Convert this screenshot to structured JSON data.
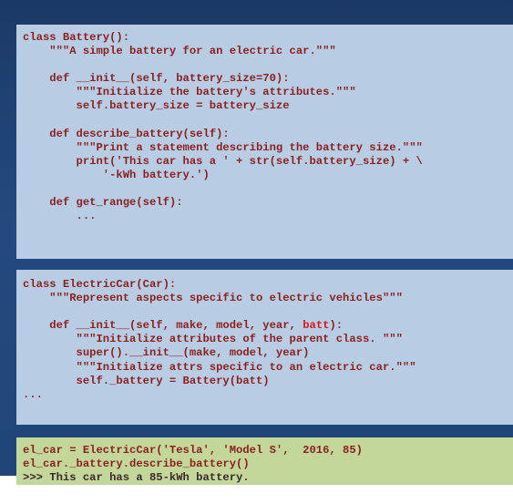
{
  "code_block_1": {
    "lines": [
      "class Battery():",
      "    \"\"\"A simple battery for an electric car.\"\"\"",
      "",
      "    def __init__(self, battery_size=70):",
      "        \"\"\"Initialize the battery's attributes.\"\"\"",
      "        self.battery_size = battery_size",
      "",
      "    def describe_battery(self):",
      "        \"\"\"Print a statement describing the battery size.\"\"\"",
      "        print('This car has a ' + str(self.battery_size) + \\",
      "            '-kWh battery.')",
      "",
      "    def get_range(self):",
      "        ..."
    ]
  },
  "code_block_2": {
    "lines": [
      "class ElectricCar(Car):",
      "    \"\"\"Represent aspects specific to electric vehicles\"\"\"",
      "",
      "    def __init__(self, make, model, year, batt):",
      "        \"\"\"Initialize attributes of the parent class. \"\"\"",
      "        super().__init__(make, model, year)",
      "        \"\"\"Initialize attrs specific to an electric car.\"\"\"",
      "        self._battery = Battery(batt)",
      "..."
    ],
    "line4_prefix": "    def __init__(self, make, model, year, ",
    "line4_highlight": "batt",
    "line4_suffix": "):"
  },
  "code_block_3": {
    "line1": "el_car = ElectricCar('Tesla', 'Model S',  2016, 85)",
    "line2": "el_car._battery.describe_battery()",
    "line3": ">>> This car has a 85-kWh battery."
  },
  "colors": {
    "background": "#234a80",
    "code_box_blue": "#b8cce4",
    "code_box_green": "#c4d79b",
    "code_text": "#8a1f1f",
    "highlight_text": "#d9141b",
    "prompt_text": "#3a2a2a"
  }
}
